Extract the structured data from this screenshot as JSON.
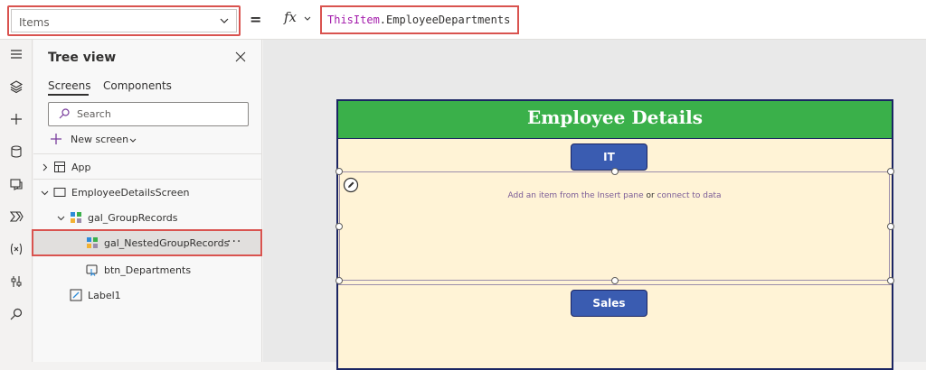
{
  "formula_bar": {
    "property": "Items",
    "equals": "=",
    "fx_label": "fx",
    "formula_keyword": "ThisItem",
    "formula_rest": ".EmployeeDepartments"
  },
  "tree_view": {
    "title": "Tree view",
    "tabs": [
      "Screens",
      "Components"
    ],
    "search_placeholder": "Search",
    "new_screen_label": "New screen",
    "nodes": {
      "app": "App",
      "screen": "EmployeeDetailsScreen",
      "gallery": "gal_GroupRecords",
      "nested_gallery": "gal_NestedGroupRecords",
      "button": "btn_Departments",
      "label": "Label1"
    },
    "more_label": "···"
  },
  "canvas": {
    "header_title": "Employee Details",
    "buttons": [
      "IT",
      "Sales"
    ],
    "gallery_hint": {
      "part1": "Add an item from the Insert pane",
      "or": "or",
      "part2": "connect to data"
    }
  },
  "colors": {
    "highlight_red": "#d9534f",
    "header_green": "#3ab04a",
    "button_blue": "#3a5cb1",
    "frame_navy": "#1b2563",
    "canvas_bg": "#fff3d6",
    "keyword_purple": "#a31aab"
  },
  "icons": {
    "rail": [
      "hamburger-icon",
      "layers-icon",
      "plus-icon",
      "database-icon",
      "media-icon",
      "power-automate-icon",
      "variable-icon",
      "tools-icon",
      "search-icon"
    ]
  }
}
